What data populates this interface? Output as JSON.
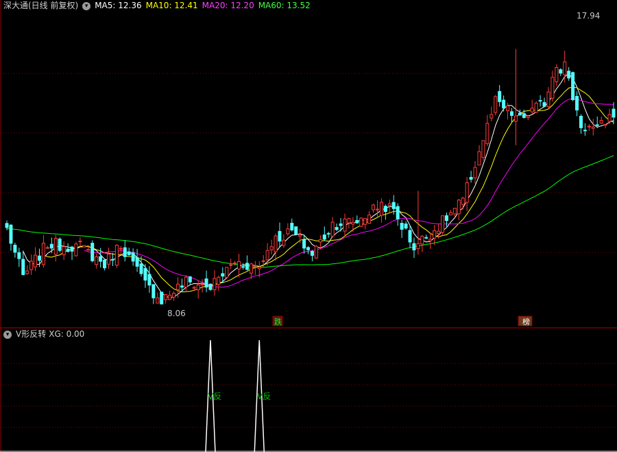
{
  "header": {
    "title": "深大通(日线 前复权)",
    "ma5_label": "MA5: 12.36",
    "ma10_label": "MA10: 12.41",
    "ma20_label": "MA20: 12.20",
    "ma60_label": "MA60: 13.52"
  },
  "indicator": {
    "label": "V形反转",
    "xg_label": "XG: 0.00",
    "signal_label": "V反"
  },
  "markers": {
    "high_label": "17.94",
    "low_label": "8.06",
    "event1": "跌",
    "event2": "榜"
  },
  "colors": {
    "up": "#ff3b3b",
    "down": "#54ffff",
    "ma5": "#ffffff",
    "ma10": "#ffff00",
    "ma20": "#ff00ff",
    "ma60": "#00ff00",
    "grid": "#8b0000",
    "signal_text": "#00c000"
  },
  "chart_data": {
    "type": "candlestick",
    "ylim": [
      7.2,
      19.4
    ],
    "count": 150,
    "low_price": 8.06,
    "high_price": 17.94,
    "anchors": [
      [
        0,
        10.9
      ],
      [
        4,
        9.0
      ],
      [
        10,
        10.3
      ],
      [
        18,
        10.2
      ],
      [
        24,
        9.5
      ],
      [
        28,
        10.3
      ],
      [
        34,
        8.7
      ],
      [
        38,
        8.1
      ],
      [
        44,
        8.8
      ],
      [
        50,
        8.6
      ],
      [
        56,
        9.6
      ],
      [
        62,
        9.4
      ],
      [
        65,
        10.4
      ],
      [
        70,
        10.8
      ],
      [
        75,
        9.9
      ],
      [
        80,
        11.1
      ],
      [
        86,
        11.2
      ],
      [
        92,
        11.9
      ],
      [
        95,
        11.6
      ],
      [
        100,
        10.2
      ],
      [
        106,
        11.0
      ],
      [
        112,
        12.0
      ],
      [
        120,
        15.9
      ],
      [
        126,
        15.2
      ],
      [
        132,
        15.9
      ],
      [
        135,
        17.5
      ],
      [
        138,
        16.7
      ],
      [
        141,
        15.0
      ],
      [
        145,
        14.8
      ],
      [
        149,
        15.5
      ]
    ],
    "ma_periods": [
      5,
      10,
      20,
      60
    ],
    "ma60_start": 10.9,
    "indicator_xg": [
      0,
      1,
      0,
      1,
      0
    ],
    "signals": [
      50,
      62
    ]
  }
}
